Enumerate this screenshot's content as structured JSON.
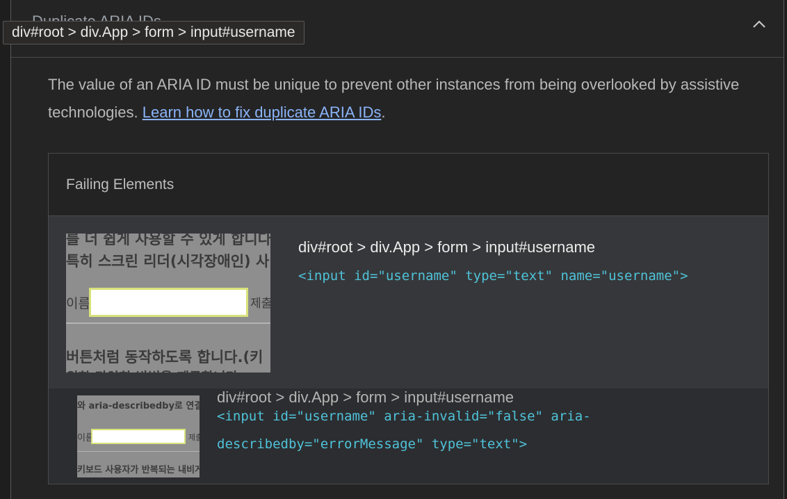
{
  "tooltip": "div#root > div.App > form > input#username",
  "header": {
    "title": "Duplicate ARIA IDs",
    "collapse_icon": "chevron-up-icon"
  },
  "description": {
    "text": "The value of an ARIA ID must be unique to prevent other instances from being overlooked by assistive technologies. ",
    "link": "Learn how to fix duplicate ARIA IDs",
    "end": "."
  },
  "failing": {
    "heading": "Failing Elements",
    "items": [
      {
        "selector": "div#root > div.App > form > input#username",
        "code": "<input id=\"username\" type=\"text\" name=\"username\">",
        "thumb": {
          "line1": "를 더 쉽게 사용할 수 있게 합니다",
          "line2": "특히 스크린 리더(시각장애인) 사",
          "label": "이름",
          "button": "제출",
          "line3": "버튼처럼 동작하도록 합니다.(키",
          "line4": "위한 다양한 방법을 제공합니다"
        }
      },
      {
        "selector": "div#root > div.App > form > input#username",
        "code": "<input id=\"username\" aria-invalid=\"false\" aria-describedby=\"errorMessage\" type=\"text\">",
        "thumb": {
          "line1": "와 aria-describedby로 연결해",
          "label": "이름",
          "button": "제출",
          "line2": "키보드 사용자가 반복되는 내비게"
        }
      }
    ]
  },
  "colors": {
    "link": "#8ab4f8",
    "code": "#4fc3d9",
    "highlight": "#d8e27a"
  }
}
